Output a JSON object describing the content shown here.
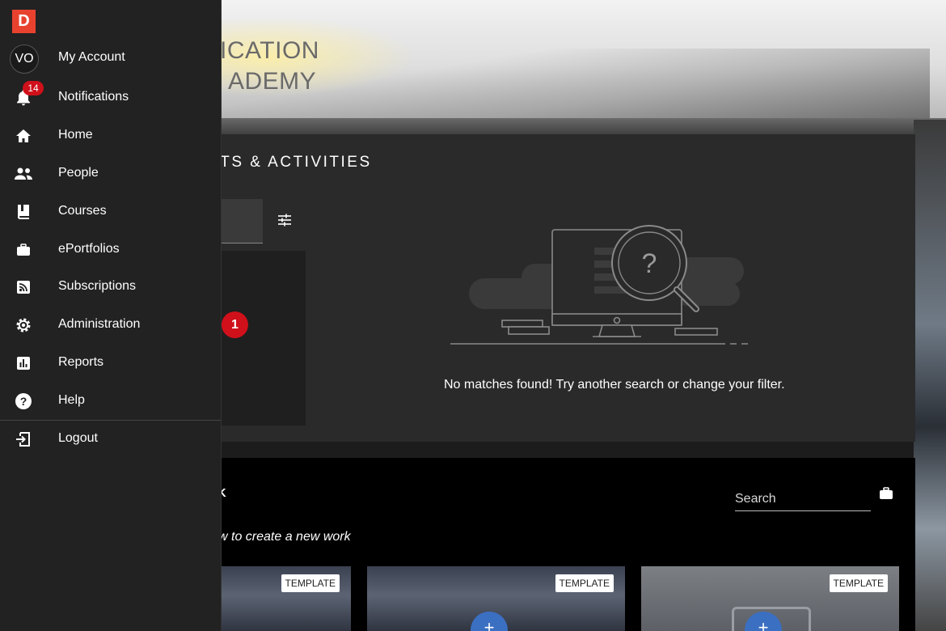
{
  "hero": {
    "title_line1": "ICATION",
    "title_line2": "ADEMY"
  },
  "events": {
    "heading": "NTS & ACTIVITIES",
    "count_badge": "1",
    "empty_message": "No matches found! Try another search or change your filter."
  },
  "work": {
    "heading": "RK",
    "hint": "w to create a new work",
    "search_placeholder": "Search",
    "templates": [
      {
        "label": "TEMPLATE"
      },
      {
        "label": "TEMPLATE"
      },
      {
        "label": "TEMPLATE"
      }
    ],
    "add_symbol": "+"
  },
  "sidebar": {
    "logo": "D",
    "avatar_initials": "VO",
    "notification_count": "14",
    "items": [
      {
        "label": "My Account",
        "icon": "avatar-icon"
      },
      {
        "label": "Notifications",
        "icon": "bell-icon"
      },
      {
        "label": "Home",
        "icon": "home-icon"
      },
      {
        "label": "People",
        "icon": "people-icon"
      },
      {
        "label": "Courses",
        "icon": "book-icon"
      },
      {
        "label": "ePortfolios",
        "icon": "briefcase-icon"
      },
      {
        "label": "Subscriptions",
        "icon": "rss-icon"
      },
      {
        "label": "Administration",
        "icon": "gear-icon"
      },
      {
        "label": "Reports",
        "icon": "chart-icon"
      },
      {
        "label": "Help",
        "icon": "help-icon"
      },
      {
        "label": "Logout",
        "icon": "logout-icon"
      }
    ]
  },
  "colors": {
    "sidebar_bg": "#222222",
    "accent_red": "#d0101a",
    "logo_red": "#e8422f",
    "add_blue": "#3b6fc2"
  }
}
